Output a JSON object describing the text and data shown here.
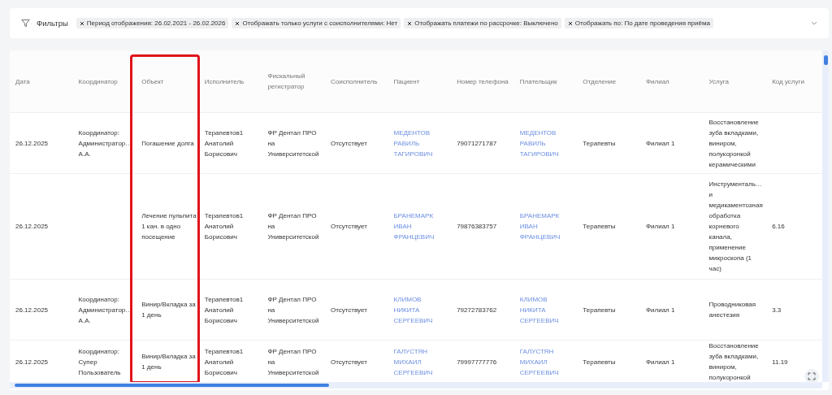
{
  "filters": {
    "label": "Фильтры",
    "chips": [
      "Период отображения: 26.02.2021 - 26.02.2026",
      "Отображать только услуги с соисполнителями: Нет",
      "Отображать платежи по рассрочке: Выключено",
      "Отображать по: По дате проведения приёма"
    ]
  },
  "table": {
    "columns": [
      {
        "label": "Дата",
        "kind": "text",
        "highlighted": false
      },
      {
        "label": "Координатор",
        "kind": "text",
        "highlighted": false
      },
      {
        "label": "Объект",
        "kind": "text",
        "highlighted": true
      },
      {
        "label": "Исполнитель",
        "kind": "text",
        "highlighted": false
      },
      {
        "label": "Фискальный регистратор",
        "kind": "text",
        "highlighted": false
      },
      {
        "label": "Соисполнитель",
        "kind": "text",
        "highlighted": false
      },
      {
        "label": "Пациент",
        "kind": "link",
        "highlighted": false
      },
      {
        "label": "Номер телефона",
        "kind": "text",
        "highlighted": false
      },
      {
        "label": "Плательщик",
        "kind": "link",
        "highlighted": false
      },
      {
        "label": "Отделение",
        "kind": "text",
        "highlighted": false
      },
      {
        "label": "Филиал",
        "kind": "text",
        "highlighted": false
      },
      {
        "label": "Услуга",
        "kind": "text",
        "highlighted": false
      },
      {
        "label": "Код услуги",
        "kind": "text",
        "highlighted": false
      }
    ],
    "rows": [
      [
        "26.12.2025",
        "Координатор: Администратор… А.А.",
        "Погашение долга",
        "Терапевтов1 Анатолий Борисович",
        "ФР Дентал ПРО на Университетской",
        "Отсутствует",
        "МЕДЕНТОВ РАВИЛЬ ТАГИРОВИЧ",
        "79071271787",
        "МЕДЕНТОВ РАВИЛЬ ТАГИРОВИЧ",
        "Терапевты",
        "Филиал 1",
        "Восстановление зуба вкладками, виниром, полукоронкой керамическими",
        ""
      ],
      [
        "26.12.2025",
        "",
        "Лечение пульпита 1 кан. в одно посещение",
        "Терапевтов1 Анатолий Борисович",
        "ФР Дентал ПРО на Университетской",
        "Отсутствует",
        "БРАНЕМАРК ИВАН ФРАНЦЕВИЧ",
        "79876383757",
        "БРАНЕМАРК ИВАН ФРАНЦЕВИЧ",
        "Терапевты",
        "Филиал 1",
        "Инструменталь… и медикаментозная обработка корневого канала, применение микроскопа (1 час)",
        "6.16"
      ],
      [
        "26.12.2025",
        "Координатор: Администратор… А.А.",
        "Винир/Вкладка за 1 день",
        "Терапевтов1 Анатолий Борисович",
        "ФР Дентал ПРО на Университетской",
        "Отсутствует",
        "КЛИМОВ НИКИТА СЕРГЕЕВИЧ",
        "79272783762",
        "КЛИМОВ НИКИТА СЕРГЕЕВИЧ",
        "Терапевты",
        "Филиал 1",
        "Проводниковая анестезия",
        "3.3"
      ],
      [
        "26.12.2025",
        "Координатор: Супер Пользователь",
        "Винир/Вкладка за 1 день",
        "Терапевтов1 Анатолий Борисович",
        "ФР Дентал ПРО на Университетской",
        "Отсутствует",
        "ГАЛУСТЯН МИХАИЛ СЕРГЕЕВИЧ",
        "79997777776",
        "ГАЛУСТЯН МИХАИЛ СЕРГЕЕВИЧ",
        "Терапевты",
        "Филиал 1",
        "Восстановление зуба вкладками, виниром, полукоронкой",
        "11.19"
      ]
    ]
  }
}
